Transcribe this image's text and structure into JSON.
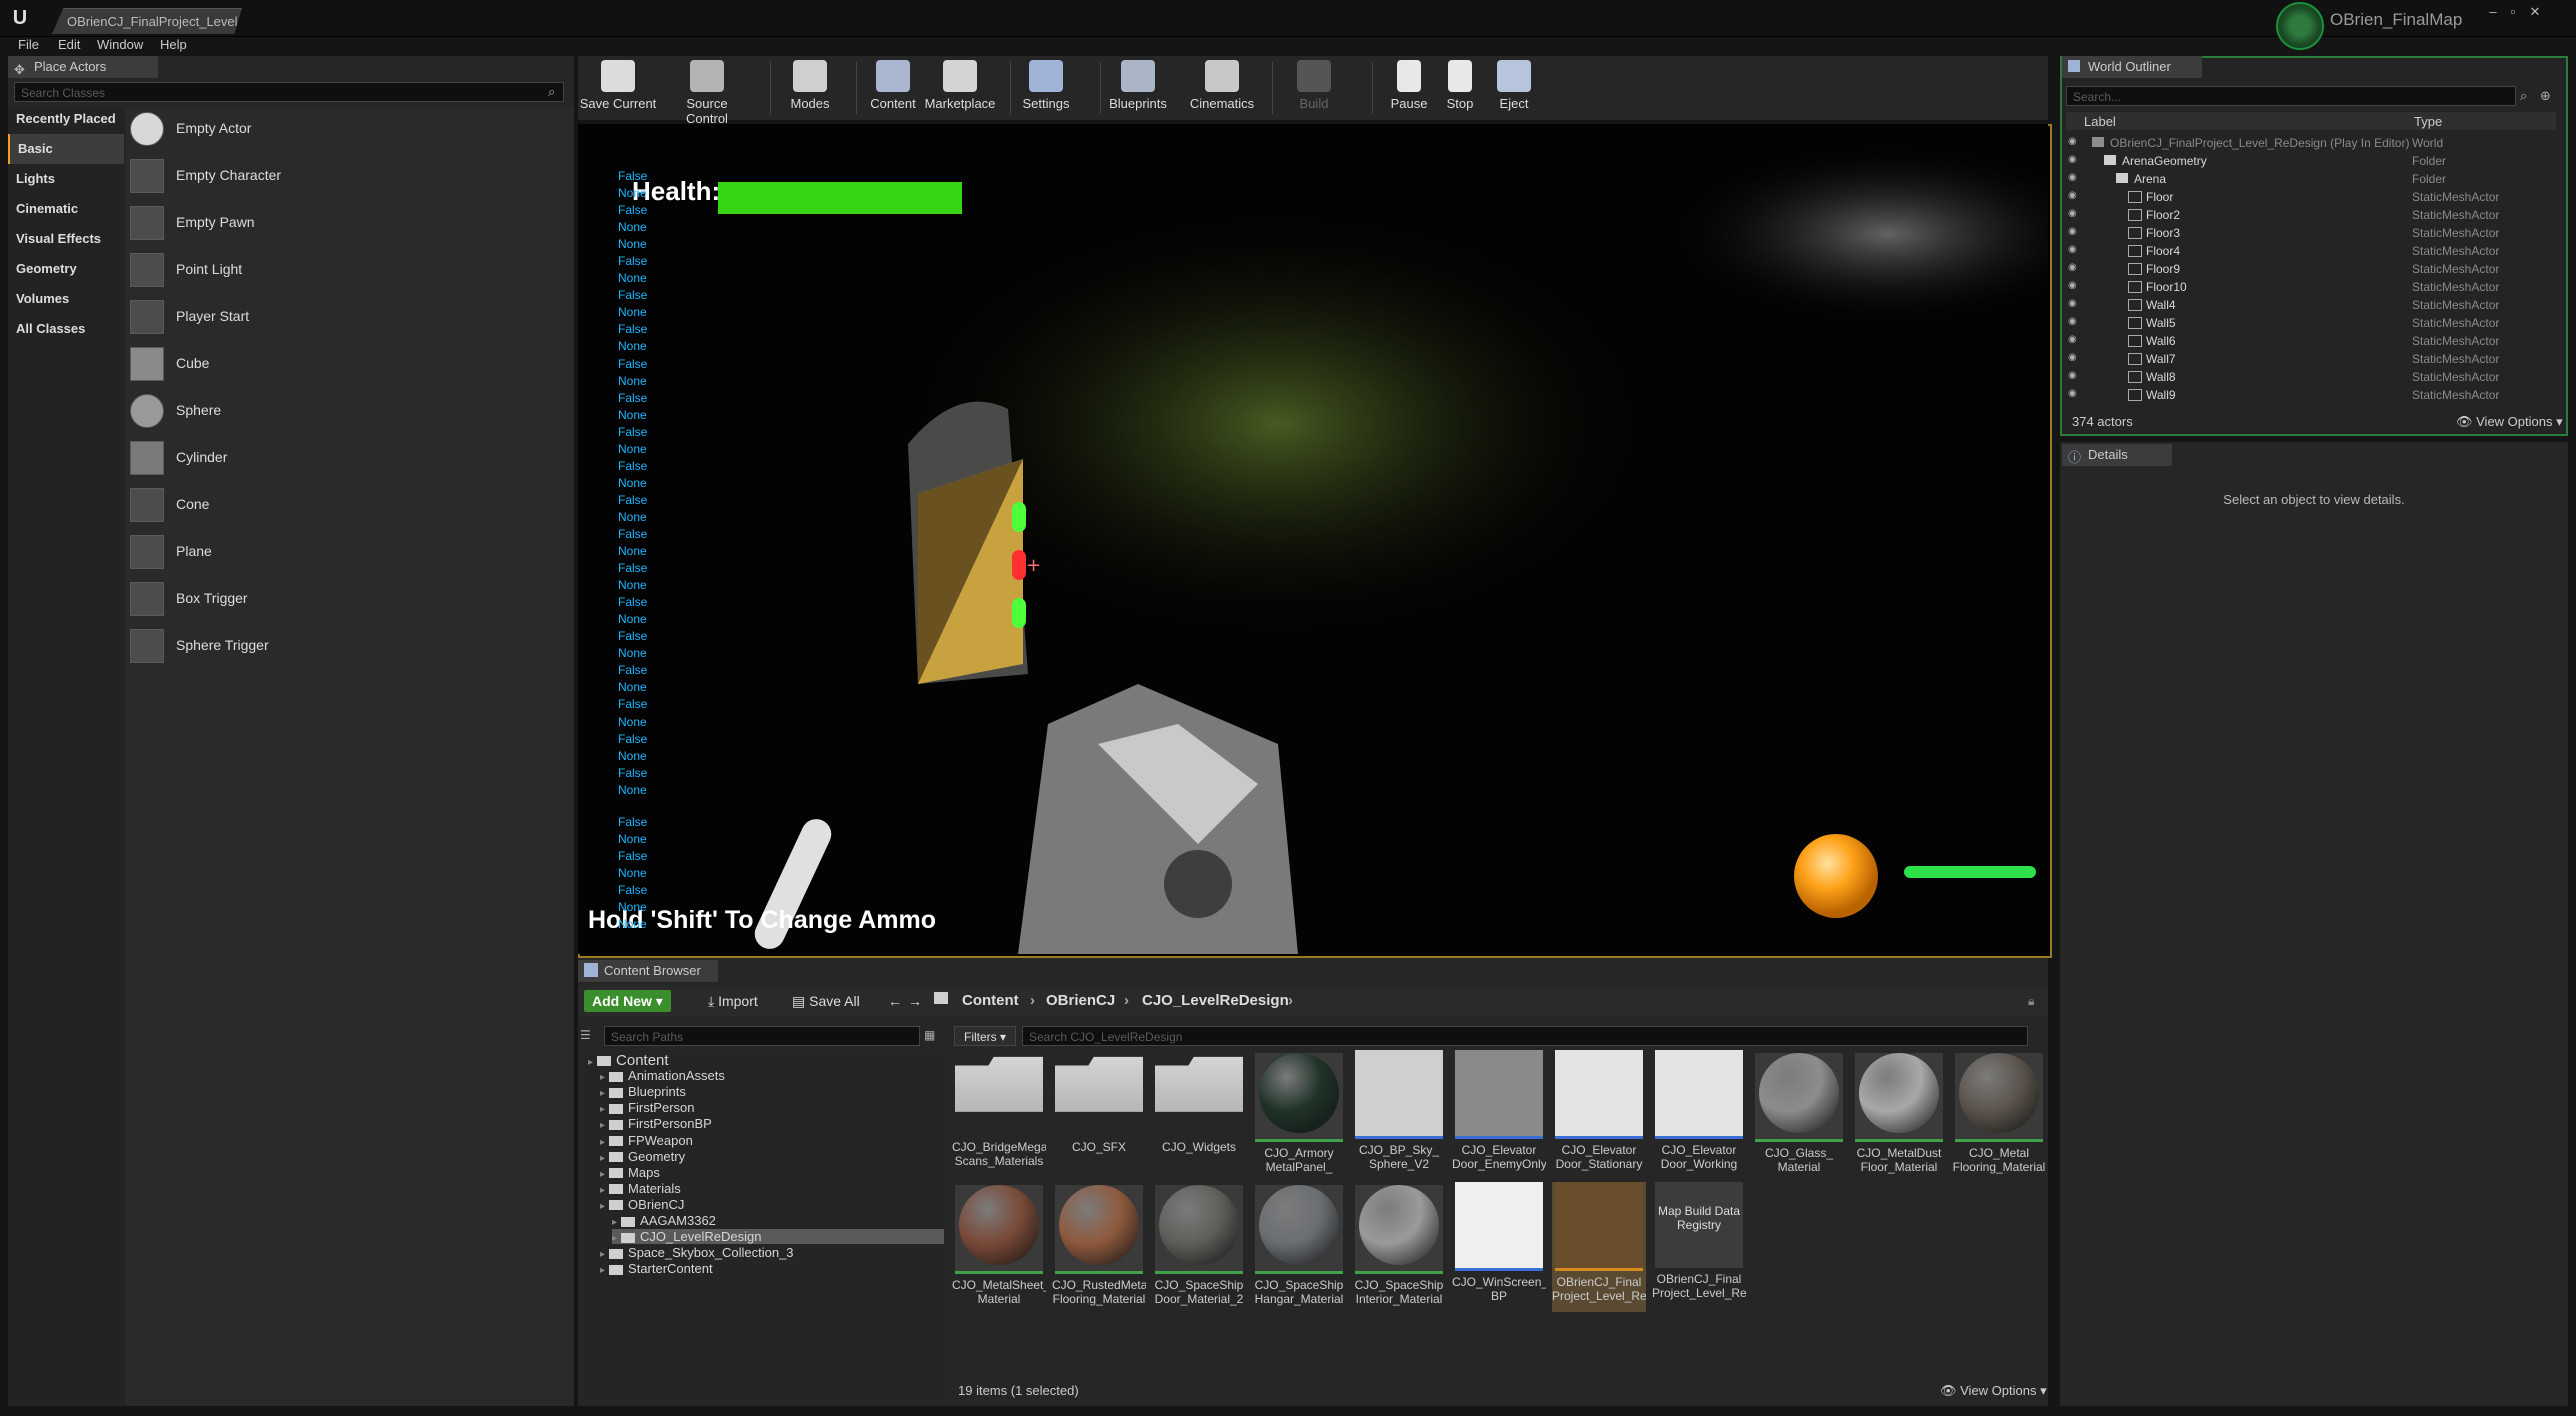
{
  "window": {
    "doc_tab": "OBrienCJ_FinalProject_Level",
    "project_name": "OBrien_FinalMap",
    "controls": [
      "–",
      "▫",
      "✕"
    ]
  },
  "menu": [
    "File",
    "Edit",
    "Window",
    "Help"
  ],
  "place_actors": {
    "tab_label": "Place Actors",
    "search_placeholder": "Search Classes",
    "categories": [
      "Recently Placed",
      "Basic",
      "Lights",
      "Cinematic",
      "Visual Effects",
      "Geometry",
      "Volumes",
      "All Classes"
    ],
    "active_category": "Basic",
    "actors": [
      "Empty Actor",
      "Empty Character",
      "Empty Pawn",
      "Point Light",
      "Player Start",
      "Cube",
      "Sphere",
      "Cylinder",
      "Cone",
      "Plane",
      "Box Trigger",
      "Sphere Trigger"
    ]
  },
  "toolbar": {
    "items": [
      {
        "label": "Save Current",
        "icon": "save-icon",
        "enabled": true
      },
      {
        "label": "Source Control",
        "icon": "source-control-icon",
        "enabled": true
      },
      {
        "label": "Modes",
        "icon": "modes-icon",
        "enabled": true
      },
      {
        "label": "Content",
        "icon": "content-icon",
        "enabled": true
      },
      {
        "label": "Marketplace",
        "icon": "marketplace-icon",
        "enabled": true
      },
      {
        "label": "Settings",
        "icon": "settings-icon",
        "enabled": true
      },
      {
        "label": "Blueprints",
        "icon": "blueprints-icon",
        "enabled": true
      },
      {
        "label": "Cinematics",
        "icon": "cinematics-icon",
        "enabled": true
      },
      {
        "label": "Build",
        "icon": "build-icon",
        "enabled": false
      },
      {
        "label": "Pause",
        "icon": "pause-icon",
        "enabled": true
      },
      {
        "label": "Stop",
        "icon": "stop-icon",
        "enabled": true
      },
      {
        "label": "Eject",
        "icon": "eject-icon",
        "enabled": true
      }
    ]
  },
  "viewport": {
    "health_label": "Health:",
    "health_fraction": 1.0,
    "ammo_hint": "Hold 'Shift' To Change Ammo",
    "debug_lines_top": [
      "False",
      "None",
      "False",
      "None",
      "None",
      "False",
      "None",
      "False",
      "None",
      "False",
      "None",
      "False",
      "None",
      "False",
      "None",
      "False",
      "None",
      "False",
      "None",
      "False",
      "None",
      "False",
      "None",
      "False",
      "None",
      "False",
      "None",
      "False",
      "None",
      "False",
      "None",
      "False",
      "None",
      "False",
      "None",
      "False",
      "None"
    ],
    "debug_lines_bottom": [
      "False",
      "None",
      "False",
      "None",
      "False",
      "None",
      "None"
    ],
    "colors": {
      "health": "#36d613",
      "ammo_bar": "#2ee04a",
      "ammo_orb": "#ffa21a",
      "border": "#9b7b20"
    }
  },
  "content_browser": {
    "tab_label": "Content Browser",
    "add_new": "Add New",
    "import": "Import",
    "save_all": "Save All",
    "breadcrumbs": [
      "Content",
      "OBrienCJ",
      "CJO_LevelReDesign"
    ],
    "search_paths_placeholder": "Search Paths",
    "filters_label": "Filters",
    "search_assets_placeholder": "Search CJO_LevelReDesign",
    "tree": [
      {
        "label": "Content",
        "depth": 0,
        "selected": false
      },
      {
        "label": "AnimationAssets",
        "depth": 1,
        "selected": false
      },
      {
        "label": "Blueprints",
        "depth": 1,
        "selected": false
      },
      {
        "label": "FirstPerson",
        "depth": 1,
        "selected": false
      },
      {
        "label": "FirstPersonBP",
        "depth": 1,
        "selected": false
      },
      {
        "label": "FPWeapon",
        "depth": 1,
        "selected": false
      },
      {
        "label": "Geometry",
        "depth": 1,
        "selected": false
      },
      {
        "label": "Maps",
        "depth": 1,
        "selected": false
      },
      {
        "label": "Materials",
        "depth": 1,
        "selected": false
      },
      {
        "label": "OBrienCJ",
        "depth": 1,
        "selected": false
      },
      {
        "label": "AAGAM3362",
        "depth": 2,
        "selected": false
      },
      {
        "label": "CJO_LevelReDesign",
        "depth": 2,
        "selected": true
      },
      {
        "label": "Space_Skybox_Collection_3",
        "depth": 1,
        "selected": false
      },
      {
        "label": "StarterContent",
        "depth": 1,
        "selected": false
      }
    ],
    "assets": [
      {
        "label": "CJO_BridgeMega Scans_Materials",
        "kind": "folder"
      },
      {
        "label": "CJO_SFX",
        "kind": "folder"
      },
      {
        "label": "CJO_Widgets",
        "kind": "folder"
      },
      {
        "label": "CJO_Armory MetalPanel_ Material",
        "kind": "material",
        "color": "#1f3328"
      },
      {
        "label": "CJO_BP_Sky_ Sphere_V2",
        "kind": "blueprint",
        "color": "#cfcfcf"
      },
      {
        "label": "CJO_Elevator Door_EnemyOnly",
        "kind": "blueprint",
        "color": "#8a8a8a"
      },
      {
        "label": "CJO_Elevator Door_Stationary",
        "kind": "blueprint",
        "color": "#e4e4e4"
      },
      {
        "label": "CJO_Elevator Door_Working",
        "kind": "blueprint",
        "color": "#e4e4e4"
      },
      {
        "label": "CJO_Glass_ Material",
        "kind": "material",
        "color": "#8c8c8c"
      },
      {
        "label": "CJO_MetalDust Floor_Material",
        "kind": "material",
        "color": "#a8a8a8"
      },
      {
        "label": "CJO_Metal Flooring_Material",
        "kind": "material",
        "color": "#5b544d"
      },
      {
        "label": "CJO_MetalSheet_ Material",
        "kind": "material",
        "color": "#7a4a38"
      },
      {
        "label": "CJO_RustedMetal Flooring_Material",
        "kind": "material",
        "color": "#8f5a3e"
      },
      {
        "label": "CJO_SpaceShip Door_Material_2",
        "kind": "material",
        "color": "#5e5e5a"
      },
      {
        "label": "CJO_SpaceShip Hangar_Material",
        "kind": "material",
        "color": "#6a6e72"
      },
      {
        "label": "CJO_SpaceShip Interior_Material",
        "kind": "material",
        "color": "#9a9a9a"
      },
      {
        "label": "CJO_WinScreen_ BP",
        "kind": "blueprint",
        "color": "#f0f0f0"
      },
      {
        "label": "OBrienCJ_Final Project_Level_Re Design",
        "kind": "map",
        "color": "#6a4d2a"
      },
      {
        "label": "OBrienCJ_Final Project_Level_Re Design_BuiltData",
        "kind": "data",
        "text": "Map Build Data Registry"
      }
    ],
    "items_count": "19 items (1 selected)",
    "view_options": "View Options"
  },
  "world_outliner": {
    "tab_label": "World Outliner",
    "search_placeholder": "Search...",
    "col_label": "Label",
    "col_type": "Type",
    "rows": [
      {
        "label": "OBrienCJ_FinalProject_Level_ReDesign (Play In Editor)",
        "type": "World",
        "depth": 0
      },
      {
        "label": "ArenaGeometry",
        "type": "Folder",
        "depth": 1
      },
      {
        "label": "Arena",
        "type": "Folder",
        "depth": 2
      },
      {
        "label": "Floor",
        "type": "StaticMeshActor",
        "depth": 3
      },
      {
        "label": "Floor2",
        "type": "StaticMeshActor",
        "depth": 3
      },
      {
        "label": "Floor3",
        "type": "StaticMeshActor",
        "depth": 3
      },
      {
        "label": "Floor4",
        "type": "StaticMeshActor",
        "depth": 3
      },
      {
        "label": "Floor9",
        "type": "StaticMeshActor",
        "depth": 3
      },
      {
        "label": "Floor10",
        "type": "StaticMeshActor",
        "depth": 3
      },
      {
        "label": "Wall4",
        "type": "StaticMeshActor",
        "depth": 3
      },
      {
        "label": "Wall5",
        "type": "StaticMeshActor",
        "depth": 3
      },
      {
        "label": "Wall6",
        "type": "StaticMeshActor",
        "depth": 3
      },
      {
        "label": "Wall7",
        "type": "StaticMeshActor",
        "depth": 3
      },
      {
        "label": "Wall8",
        "type": "StaticMeshActor",
        "depth": 3
      },
      {
        "label": "Wall9",
        "type": "StaticMeshActor",
        "depth": 3
      }
    ],
    "actor_count": "374 actors",
    "view_options": "View Options"
  },
  "details": {
    "tab_label": "Details",
    "empty_message": "Select an object to view details."
  }
}
